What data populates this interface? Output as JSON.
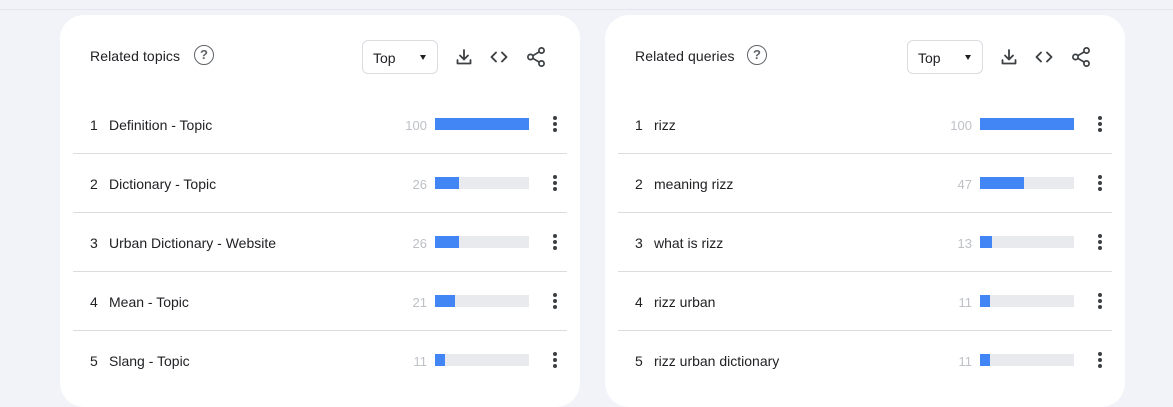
{
  "panels": [
    {
      "title": "Related topics",
      "help_icon": "help-circle-icon",
      "help_glyph": "?",
      "select": {
        "value": "Top"
      },
      "tools": [
        "download-icon",
        "embed-code-icon",
        "share-icon"
      ],
      "items": [
        {
          "rank": "1",
          "label": "Definition - Topic",
          "value": "100",
          "level": 100
        },
        {
          "rank": "2",
          "label": "Dictionary - Topic",
          "value": "26",
          "level": 26
        },
        {
          "rank": "3",
          "label": "Urban Dictionary - Website",
          "value": "26",
          "level": 26
        },
        {
          "rank": "4",
          "label": "Mean - Topic",
          "value": "21",
          "level": 21
        },
        {
          "rank": "5",
          "label": "Slang - Topic",
          "value": "11",
          "level": 11
        }
      ]
    },
    {
      "title": "Related queries",
      "help_icon": "help-circle-icon",
      "help_glyph": "?",
      "select": {
        "value": "Top"
      },
      "tools": [
        "download-icon",
        "embed-code-icon",
        "share-icon"
      ],
      "items": [
        {
          "rank": "1",
          "label": "rizz",
          "value": "100",
          "level": 100
        },
        {
          "rank": "2",
          "label": "meaning rizz",
          "value": "47",
          "level": 47
        },
        {
          "rank": "3",
          "label": "what is rizz",
          "value": "13",
          "level": 13
        },
        {
          "rank": "4",
          "label": "rizz urban",
          "value": "11",
          "level": 11
        },
        {
          "rank": "5",
          "label": "rizz urban dictionary",
          "value": "11",
          "level": 11
        }
      ]
    }
  ],
  "colors": {
    "bar_fill": "#4285f4",
    "bar_track": "#e8eaed",
    "page_background": "#f1f3f8",
    "card_background": "#ffffff"
  }
}
